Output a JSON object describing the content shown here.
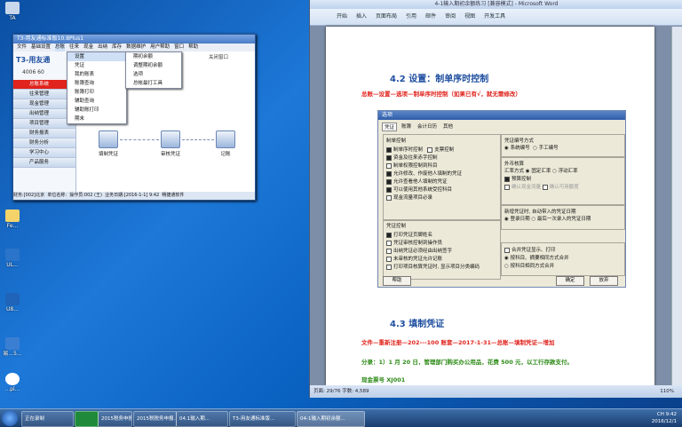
{
  "desktop": {
    "icons": [
      "TA",
      "2015税务D...",
      "20...",
      "图...",
      "Fe...",
      "UL...",
      "U8...",
      "...",
      "易...5...",
      "...pl..."
    ]
  },
  "t3": {
    "title": "T3-用友通标准版10.8Plus1",
    "menu": [
      "文件",
      "基础设置",
      "总账",
      "往来",
      "现金",
      "出纳",
      "库存",
      "数据维护",
      "用户帮助",
      "窗口",
      "帮助"
    ],
    "logo": "T3-用友通",
    "phone": "4006 60",
    "nav": [
      "总账系统",
      "往来管理",
      "现金管理",
      "出纳管理",
      "项目管理",
      "财务报表",
      "财务分析",
      "学习中心",
      "产品服务"
    ],
    "dropdown1": [
      "设置",
      "凭证",
      "我的账表",
      "账簿查询",
      "账簿打印",
      "辅助查询",
      "辅助账打印",
      "期末"
    ],
    "dropdown2": [
      "期初余额",
      "调整期初余额",
      "选项",
      "总帐最打工具"
    ],
    "close_label": "关闭窗口",
    "flow": [
      "填制凭证",
      "审核凭证",
      "记账"
    ],
    "status": [
      "财务:[002]北京",
      "单位名称:",
      "操作员:002 (王)",
      "业务日期:[2016-1-1] 9:42",
      "畅捷通软件"
    ]
  },
  "word": {
    "title": "4-1输入期初余额练习 [兼容模式] - Microsoft Word",
    "tabs": [
      "开始",
      "插入",
      "页面布局",
      "引用",
      "邮件",
      "审阅",
      "视图",
      "开发工具"
    ],
    "heading1": "4.2   设置：制单序时控制",
    "instr1": "总账—设置—选项—制单序时控制（如果已有√，就无需修改）",
    "heading2": "4.3   填制凭证",
    "instr2": "文件—重新注册—202---100 账套—2017-1-31—总账—填制凭证—增加",
    "line3": "分录：1）1 月 20 日，管理部门购买办公用品，花费 500 元，以工行存款支付。",
    "line4": "现金票号 XJ001",
    "status_left": "页面: 29/76   字数: 4,589",
    "zoom": "110%"
  },
  "dialog": {
    "title": "选项",
    "tabs": [
      "凭证",
      "账簿",
      "会计日历",
      "其他"
    ],
    "group1_title": "制单控制",
    "group1": [
      {
        "label": "制单序时控制",
        "checked": true
      },
      {
        "label": "支票控制",
        "checked": false
      },
      {
        "label": "资金及往来赤字控制",
        "checked": true
      },
      {
        "label": "制单权限控制到科目",
        "checked": false
      },
      {
        "label": "允许修改、作废他人填制的凭证",
        "checked": true
      },
      {
        "label": "允许查看他人填制的凭证",
        "checked": true
      },
      {
        "label": "可以使用其他系统受控科目",
        "checked": true
      },
      {
        "label": "现金流量项目必录",
        "checked": false
      }
    ],
    "group2_title": "凭证控制",
    "group2": [
      {
        "label": "打印凭证页脚姓名",
        "checked": true
      },
      {
        "label": "凭证审核控制到操作员",
        "checked": false
      },
      {
        "label": "出纳凭证必须经由出纳签字",
        "checked": false
      },
      {
        "label": "未审核的凭证允许记账",
        "checked": false
      },
      {
        "label": "打印项目核算凭证时, 显示项目分类编码",
        "checked": false
      }
    ],
    "group3_title": "凭证编号方式",
    "group3": [
      "系统编号",
      "手工编号"
    ],
    "group4_title": "外币核算",
    "group4": [
      "汇率方式",
      "固定汇率",
      "浮动汇率"
    ],
    "group4b": [
      "预算控制",
      "确认现金流量",
      "确认可用额度"
    ],
    "group5_title": "新增凭证时, 自动带入的凭证日期",
    "group5": [
      "登录日期",
      "最后一次录入的凭证日期"
    ],
    "group6": [
      "合并凭证显示、打印",
      "按科目、摘要相同方式合并",
      "按科目相同方式合并"
    ],
    "help": "帮助",
    "ok": "确定",
    "cancel": "放弃"
  },
  "taskbar": {
    "items": [
      "正在录制",
      "2015税务申报...",
      "2015税税务申报...",
      "04.1输入期...",
      "T3-用友通标准版...",
      "04-1输入期初余额..."
    ],
    "tray": [
      "CH",
      "9:42",
      "2016/12/1"
    ]
  }
}
